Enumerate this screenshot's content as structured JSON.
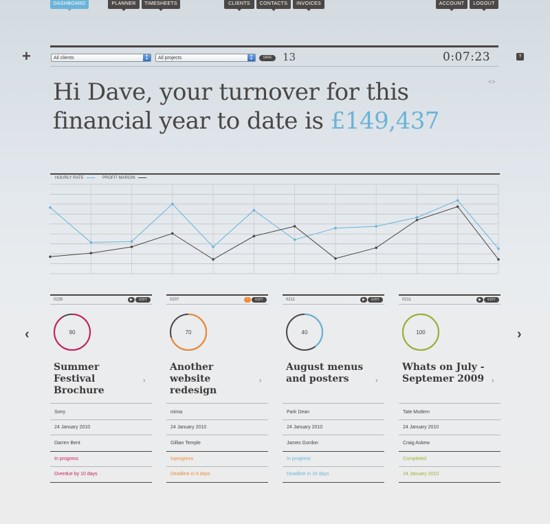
{
  "nav": {
    "dashboard": "DASHBOARD",
    "planner": "PLANNER",
    "timesheets": "TIMESHEETS",
    "clients": "CLIENTS",
    "contacts": "CONTACTS",
    "invoices": "INVOICES",
    "account": "ACCOUNT",
    "logout": "LOGOUT"
  },
  "toolbar": {
    "add_label": "+",
    "client_select": "All clients",
    "project_select": "All projects",
    "save_label": "SAVE",
    "count": "13",
    "timer": "0:07:23",
    "help_label": "?"
  },
  "greeting": {
    "text": "Hi Dave, your turnover for this financial year to date is ",
    "amount": "£149,437",
    "arrows": "<>"
  },
  "colors": {
    "accent_blue": "#6bb3d7",
    "dark": "#4a4644",
    "orange": "#f08a30",
    "pink": "#cc1e5d",
    "green": "#9bb531"
  },
  "chart_data": {
    "type": "line",
    "x": [
      1,
      2,
      3,
      4,
      5,
      6,
      7,
      8,
      9,
      10,
      11,
      12
    ],
    "series": [
      {
        "name": "HOURLY RATE",
        "color": "#6bb3d7",
        "values": [
          74,
          35,
          36,
          78,
          30,
          71,
          38,
          51,
          53,
          63,
          82,
          28
        ]
      },
      {
        "name": "PROFIT MARGIN",
        "color": "#4a4644",
        "values": [
          19,
          23,
          30,
          45,
          16,
          42,
          53,
          17,
          29,
          60,
          75,
          16
        ]
      }
    ],
    "ylim": [
      0,
      100
    ],
    "grid": true,
    "legend": "top-left"
  },
  "cards": [
    {
      "id": "0235",
      "progress": 90,
      "progress_label": "90",
      "color": "#cc1e5d",
      "alert": false,
      "title": "Summer Festival Brochure",
      "play": "▶",
      "edit": "EDIT",
      "client": "Sony",
      "date": "24 January 2010",
      "contact": "Darren Bent",
      "status": "In progress",
      "deadline": "Overdue by 10 days"
    },
    {
      "id": "0207",
      "progress": 70,
      "progress_label": "70",
      "color": "#f08a30",
      "alert": true,
      "title": "Another website redesign",
      "play": "!",
      "edit": "EDIT",
      "client": "mima",
      "date": "24 January 2010",
      "contact": "Gillian Temple",
      "status": "Inprogress",
      "deadline": "Deadline in 5 days"
    },
    {
      "id": "0211",
      "progress": 40,
      "progress_label": "40",
      "color": "#6bb3d7",
      "alert": false,
      "title": "August menus and posters",
      "play": "▶",
      "edit": "EDIT",
      "client": "Park Dean",
      "date": "24 January 2010",
      "contact": "James Gordon",
      "status": "In progress",
      "deadline": "Deadline in 15 days"
    },
    {
      "id": "0211",
      "progress": 100,
      "progress_label": "100",
      "color": "#9bb531",
      "alert": false,
      "title": "Whats on July -Septemer 2009",
      "play": "▶",
      "edit": "EDIT",
      "client": "Tate Modern",
      "date": "24 January 2010",
      "contact": "Craig Askew",
      "status": "Completed",
      "deadline": "24 January 2010"
    }
  ],
  "pager": {
    "prev": "‹",
    "next": "›",
    "card_chevron": "›"
  }
}
